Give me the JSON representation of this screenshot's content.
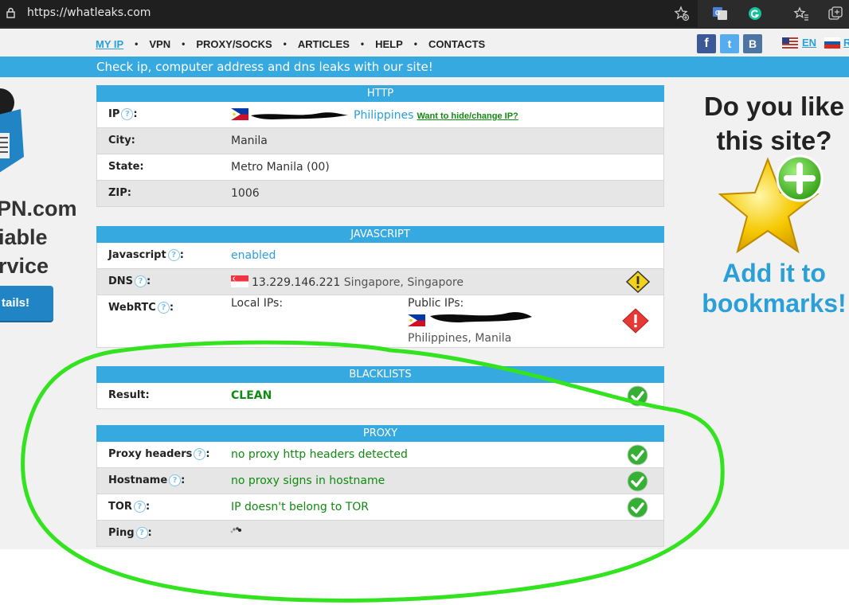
{
  "browser": {
    "url": "https://whatleaks.com"
  },
  "nav": {
    "items": [
      "MY IP",
      "VPN",
      "PROXY/SOCKS",
      "ARTICLES",
      "HELP",
      "CONTACTS"
    ],
    "dot": "•"
  },
  "social": {
    "facebook": "f",
    "twitter": "t",
    "vk": "B"
  },
  "lang": {
    "en": "EN",
    "ru": "R"
  },
  "banner": "Check ip, computer address and dns leaks with our site!",
  "left_ad": {
    "line1": "PN.com",
    "line2": "iable",
    "line3": "rvice",
    "button": "tails!"
  },
  "promo": {
    "question": "Do you like this site?",
    "action": "Add it to bookmarks!"
  },
  "help_glyph": "?",
  "http": {
    "title": "HTTP",
    "ip_label": "IP",
    "ip_country": "Philippines",
    "ip_link": "Want to hide/change IP?",
    "city_label": "City:",
    "city": "Manila",
    "state_label": "State:",
    "state": "Metro Manila (00)",
    "zip_label": "ZIP:",
    "zip": "1006"
  },
  "javascript": {
    "title": "JAVASCRIPT",
    "js_label": "Javascript",
    "js_value": "enabled",
    "dns_label": "DNS",
    "dns_ip": "13.229.146.221",
    "dns_location": "Singapore, Singapore",
    "webrtc_label": "WebRTC",
    "local_ips": "Local IPs:",
    "public_ips": "Public IPs:",
    "public_location": "Philippines, Manila"
  },
  "blacklists": {
    "title": "BLACKLISTS",
    "result_label": "Result:",
    "result": "CLEAN"
  },
  "proxy": {
    "title": "PROXY",
    "headers_label": "Proxy headers",
    "headers_value": "no proxy http headers detected",
    "hostname_label": "Hostname",
    "hostname_value": "no proxy signs in hostname",
    "tor_label": "TOR",
    "tor_value": "IP doesn't belong to TOR",
    "ping_label": "Ping"
  },
  "colors": {
    "accent": "#36a9e1",
    "ok_green": "#108a10",
    "annotation": "#33e31f"
  }
}
